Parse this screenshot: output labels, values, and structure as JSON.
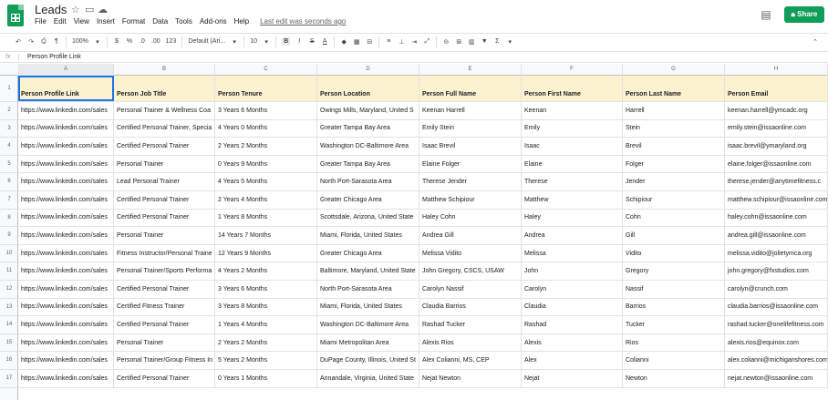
{
  "doc": {
    "title": "Leads",
    "last_edit": "Last edit was seconds ago",
    "share_label": "Share"
  },
  "menu": [
    "File",
    "Edit",
    "View",
    "Insert",
    "Format",
    "Data",
    "Tools",
    "Add-ons",
    "Help"
  ],
  "toolbar": {
    "zoom": "100%",
    "currency": "$",
    "percent": "%",
    "decimal_less": ".0",
    "decimal_more": ".00",
    "more_formats": "123",
    "font": "Default (Ari...",
    "font_size": "10",
    "bold": "B",
    "italic": "I",
    "strike": "S",
    "text_color": "A"
  },
  "formula_bar": {
    "fx": "fx",
    "content": "Person Profile Link"
  },
  "columns": [
    "A",
    "B",
    "C",
    "D",
    "E",
    "F",
    "G",
    "H"
  ],
  "row_numbers": [
    "1",
    "2",
    "3",
    "4",
    "5",
    "6",
    "7",
    "8",
    "9",
    "10",
    "11",
    "12",
    "13",
    "14",
    "15",
    "16",
    "17"
  ],
  "header_row": [
    "Person Profile Link",
    "Person Job Title",
    "Person Tenure",
    "Person Location",
    "Person Full Name",
    "Person First Name",
    "Person Last Name",
    "Person Email"
  ],
  "rows": [
    [
      "https://www.linkedin.com/sales",
      "Personal Trainer & Wellness Coa",
      "3 Years 6 Months",
      "Owings Mills, Maryland, United S",
      "Keenan Harrell",
      "Keenan",
      "Harrell",
      "keenan.harrell@ymcadc.org"
    ],
    [
      "https://www.linkedin.com/sales",
      "Certified Personal Trainer, Specia",
      "4 Years 0 Months",
      "Greater Tampa Bay Area",
      "Emily Stein",
      "Emily",
      "Stein",
      "emily.stein@issaonline.com"
    ],
    [
      "https://www.linkedin.com/sales",
      "Certified Personal Trainer",
      "2 Years 2 Months",
      "Washington DC-Baltimore Area",
      "Isaac Brevil",
      "Isaac",
      "Brevil",
      "isaac.brevil@ymaryland.org"
    ],
    [
      "https://www.linkedin.com/sales",
      "Personal Trainer",
      "0 Years 9 Months",
      "Greater Tampa Bay Area",
      "Elaine Folger",
      "Elaine",
      "Folger",
      "elaine.folger@issaonline.com"
    ],
    [
      "https://www.linkedin.com/sales",
      "Lead Personal Trainer",
      "4 Years 5 Months",
      "North Port-Sarasota Area",
      "Therese Jender",
      "Therese",
      "Jender",
      "therese.jender@anytimefitness.c"
    ],
    [
      "https://www.linkedin.com/sales",
      "Certified Personal Trainer",
      "2 Years 4 Months",
      "Greater Chicago Area",
      "Matthew Schipiour",
      "Matthew",
      "Schipiour",
      "matthew.schipiour@issaonline.com"
    ],
    [
      "https://www.linkedin.com/sales",
      "Certified Personal Trainer",
      "1 Years 8 Months",
      "Scottsdale, Arizona, United State",
      "Haley Cohn",
      "Haley",
      "Cohn",
      "haley.cohn@issaonline.com"
    ],
    [
      "https://www.linkedin.com/sales",
      "Personal Trainer",
      "14 Years 7 Months",
      "Miami, Florida, United States",
      "Andrea Gill",
      "Andrea",
      "Gill",
      "andrea.gill@issaonline.com"
    ],
    [
      "https://www.linkedin.com/sales",
      "Fitness Instructor/Personal Traine",
      "12 Years 9 Months",
      "Greater Chicago Area",
      "Melissa Vidito",
      "Melissa",
      "Vidito",
      "melissa.vidito@jolietymca.org"
    ],
    [
      "https://www.linkedin.com/sales",
      "Personal Trainer/Sports Performa",
      "4 Years 2 Months",
      "Baltimore, Maryland, United State",
      "John Gregory, CSCS, USAW",
      "John",
      "Gregory",
      "john.gregory@fxstudios.com"
    ],
    [
      "https://www.linkedin.com/sales",
      "Certified Personal Trainer",
      "3 Years 6 Months",
      "North Port-Sarasota Area",
      "Carolyn Nassif",
      "Carolyn",
      "Nassif",
      "carolyn@crunch.com"
    ],
    [
      "https://www.linkedin.com/sales",
      "Certified Fitness Trainer",
      "3 Years 8 Months",
      "Miami, Florida, United States",
      "Claudia Barrios",
      "Claudia",
      "Barrios",
      "claudia.barrios@issaonline.com"
    ],
    [
      "https://www.linkedin.com/sales",
      "Certified Personal Trainer",
      "1 Years 4 Months",
      "Washington DC-Baltimore Area",
      "Rashad Tucker",
      "Rashad",
      "Tucker",
      "rashad.tucker@onelifefitness.com"
    ],
    [
      "https://www.linkedin.com/sales",
      "Personal Trainer",
      "2 Years 2 Months",
      "Miami Metropolitan Area",
      "Alexis Rios",
      "Alexis",
      "Rios",
      "alexis.rios@equinox.com"
    ],
    [
      "https://www.linkedin.com/sales",
      "Personal Trainer/Group Fitness In",
      "5 Years 2 Months",
      "DuPage County, Illinois, United St",
      "Alex Colianni, MS, CEP",
      "Alex",
      "Colianni",
      "alex.colianni@michiganshores.com"
    ],
    [
      "https://www.linkedin.com/sales",
      "Certified Personal Trainer",
      "0 Years 1 Months",
      "Annandale, Virginia, United State",
      "Nejat Newton",
      "Nejat",
      "Newton",
      "nejat.newton@issaonline.com"
    ]
  ]
}
